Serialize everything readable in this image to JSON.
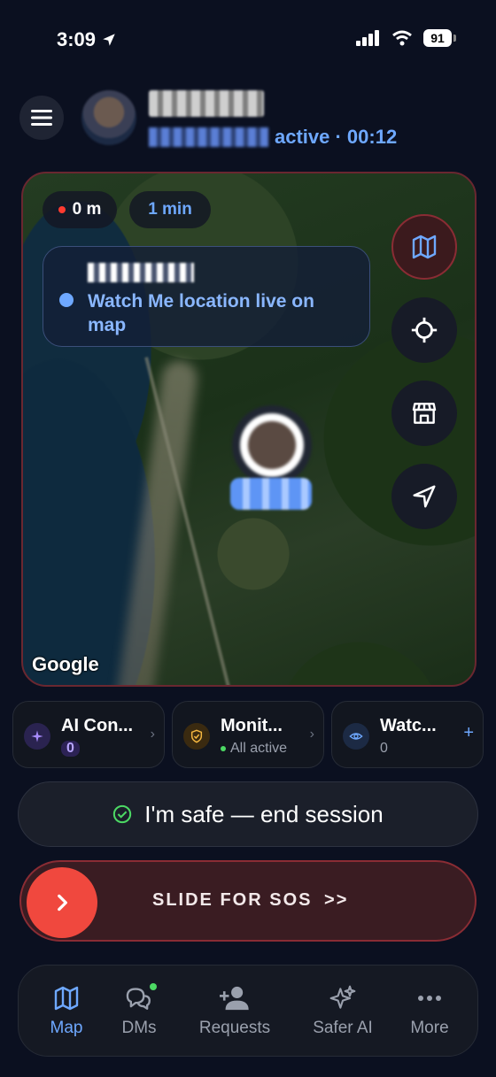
{
  "status_bar": {
    "time": "3:09",
    "battery": "91"
  },
  "header": {
    "subtitle": "active · 00:12"
  },
  "map": {
    "distance": "0 m",
    "elapsed": "1 min",
    "info_text": "Watch Me location live on map",
    "attribution": "Google"
  },
  "tiles": [
    {
      "title": "AI Con...",
      "sub": "0"
    },
    {
      "title": "Monit...",
      "sub": "All active"
    },
    {
      "title": "Watc...",
      "sub": "0"
    }
  ],
  "safe_button": {
    "label": "I'm safe — end session"
  },
  "sos": {
    "label": "SLIDE FOR SOS",
    "arrows": ">>"
  },
  "nav": [
    {
      "label": "Map"
    },
    {
      "label": "DMs"
    },
    {
      "label": "Requests"
    },
    {
      "label": "Safer AI"
    },
    {
      "label": "More"
    }
  ],
  "colors": {
    "accent": "#6ea8ff",
    "sos": "#f0483e",
    "status_ok": "#4cd964"
  }
}
